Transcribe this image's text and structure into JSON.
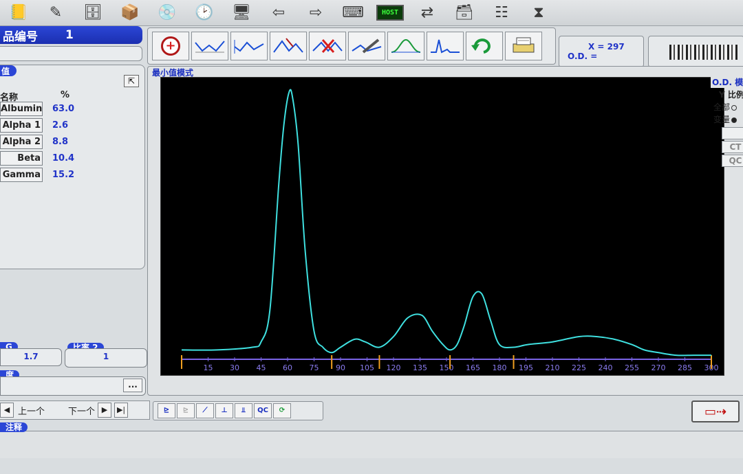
{
  "toolbar": {
    "icons": [
      "notebook-icon",
      "pen-chart-icon",
      "database-icon",
      "box-icon",
      "disc-icon",
      "clock-icon",
      "monitor-icon",
      "arrow-left-icon",
      "arrow-right-icon",
      "keyboard-icon",
      "host-icon",
      "transfer-icon",
      "archive-icon",
      "network-icon",
      "layers-icon"
    ],
    "host_label": "HOST"
  },
  "sample": {
    "label": "品编号",
    "value": "1"
  },
  "values_panel": {
    "title": "值",
    "col_name": "名称",
    "col_pct": "%",
    "fractions": [
      {
        "name": "Albumin",
        "pct": "63.0"
      },
      {
        "name": "Alpha 1",
        "pct": "2.6"
      },
      {
        "name": "Alpha 2",
        "pct": "8.8"
      },
      {
        "name": "Beta",
        "pct": "10.4"
      },
      {
        "name": "Gamma",
        "pct": "15.2"
      }
    ]
  },
  "ag": {
    "label": "G",
    "value": "1.7"
  },
  "ratio": {
    "label": "比率 2",
    "value": "1"
  },
  "degree": {
    "label": "度",
    "ellipsis": "..."
  },
  "nav": {
    "prev": "上一个",
    "next": "下一个"
  },
  "comment": {
    "label": "注释"
  },
  "coords": {
    "x_line": "X = 297",
    "od_line": "O.D. ="
  },
  "chart_panel": {
    "mode_label": "最小值模式",
    "od_mode": "O.D. 模",
    "y_ratio": "Y 比例",
    "radio_all": "全部",
    "radio_var": "变量",
    "btn_ct": "CT",
    "btn_qc": "QC"
  },
  "mini_toolbar": {
    "qc_label": "QC"
  },
  "colors": {
    "trace": "#3fe0e0",
    "axis": "#7a64e6",
    "divider": "#f0a020",
    "accent": "#2b46d6"
  },
  "chart_data": {
    "type": "line",
    "xlim": [
      0,
      300
    ],
    "x_ticks": [
      15,
      30,
      45,
      60,
      75,
      90,
      105,
      120,
      135,
      150,
      165,
      180,
      195,
      210,
      225,
      240,
      255,
      270,
      285,
      300
    ],
    "dividers": [
      0,
      85,
      112,
      152,
      188,
      300
    ],
    "series": [
      {
        "x": [
          0,
          20,
          40,
          45,
          50,
          55,
          58,
          61,
          63,
          66,
          70,
          75,
          80,
          85,
          90,
          98,
          104,
          112,
          120,
          128,
          136,
          142,
          148,
          152,
          156,
          160,
          165,
          170,
          175,
          180,
          188,
          196,
          210,
          225,
          235,
          245,
          255,
          262,
          270,
          280,
          290,
          300
        ],
        "y": [
          3,
          3,
          4,
          6,
          18,
          65,
          88,
          100,
          97,
          80,
          40,
          10,
          4,
          2,
          4,
          7,
          6,
          4,
          8,
          15,
          16,
          10,
          5,
          3,
          5,
          12,
          23,
          24,
          14,
          5,
          4,
          5,
          6,
          8,
          8,
          7,
          5,
          3,
          2,
          1,
          1,
          1
        ]
      }
    ]
  }
}
